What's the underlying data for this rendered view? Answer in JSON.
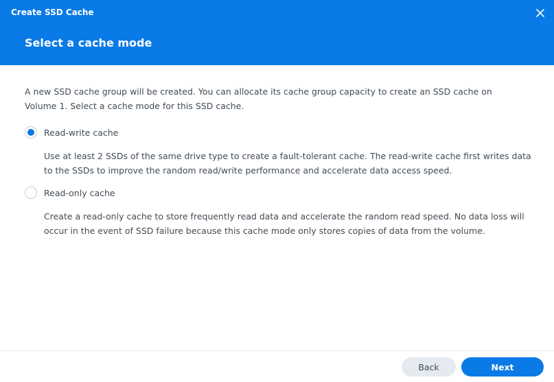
{
  "window": {
    "title": "Create SSD Cache",
    "close_icon": "close-icon"
  },
  "header": {
    "page_title": "Select a cache mode"
  },
  "main": {
    "intro": "A new SSD cache group will be created. You can allocate its cache group capacity to create an SSD cache on Volume 1. Select a cache mode for this SSD cache.",
    "options": [
      {
        "label": "Read-write cache",
        "selected": true,
        "description": "Use at least 2 SSDs of the same drive type to create a fault-tolerant cache. The read-write cache first writes data to the SSDs to improve the random read/write performance and accelerate data access speed."
      },
      {
        "label": "Read-only cache",
        "selected": false,
        "description": "Create a read-only cache to store frequently read data and accelerate the random read speed. No data loss will occur in the event of SSD failure because this cache mode only stores copies of data from the volume."
      }
    ]
  },
  "footer": {
    "back_label": "Back",
    "next_label": "Next"
  },
  "colors": {
    "accent": "#0a7ae6",
    "text": "#414b55",
    "secondary_button": "#e4eaf0"
  }
}
